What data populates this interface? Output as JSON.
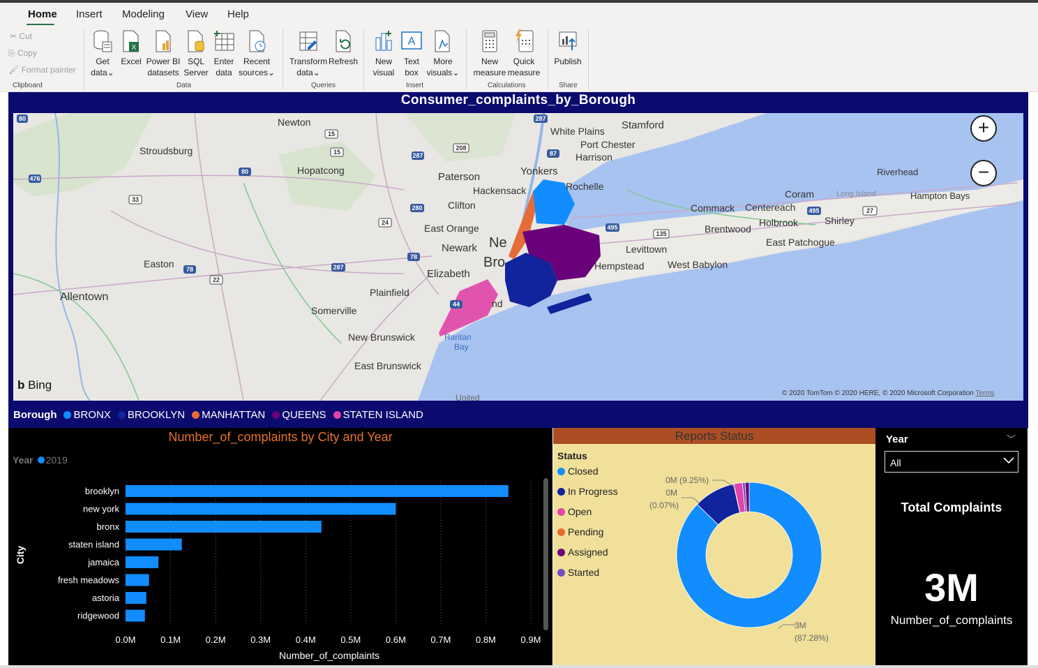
{
  "tabs": [
    "Home",
    "Insert",
    "Modeling",
    "View",
    "Help"
  ],
  "clipboard": {
    "cut": "Cut",
    "copy": "Copy",
    "format_painter": "Format painter",
    "group": "Clipboard"
  },
  "data_group": {
    "get_data": [
      "Get",
      "data"
    ],
    "excel": [
      "Excel",
      ""
    ],
    "powerbi_datasets": [
      "Power BI",
      "datasets"
    ],
    "sql_server": [
      "SQL",
      "Server"
    ],
    "enter_data": [
      "Enter",
      "data"
    ],
    "recent_sources": [
      "Recent",
      "sources"
    ],
    "group": "Data"
  },
  "queries_group": {
    "transform": [
      "Transform",
      "data"
    ],
    "refresh": [
      "Refresh",
      ""
    ],
    "group": "Queries"
  },
  "insert_group": {
    "new_visual": [
      "New",
      "visual"
    ],
    "text_box": [
      "Text",
      "box"
    ],
    "more_visuals": [
      "More",
      "visuals"
    ],
    "group": "Insert"
  },
  "calc_group": {
    "new_measure": [
      "New",
      "measure"
    ],
    "quick_measure": [
      "Quick",
      "measure"
    ],
    "group": "Calculations"
  },
  "share_group": {
    "publish": "Publish",
    "group": "Share"
  },
  "map": {
    "title": "Consumer_complaints_by_Borough",
    "zoom_in": "+",
    "zoom_out": "−",
    "bing": "Bing",
    "copyright": "© 2020 TomTom © 2020 HERE, © 2020 Microsoft Corporation",
    "terms": "Terms",
    "places": [
      "Newton",
      "Stroudsburg",
      "Hopatcong",
      "Paterson",
      "Hackensack",
      "Clifton",
      "East Orange",
      "Newark",
      "Elizabeth",
      "Plainfield",
      "Somerville",
      "New Brunswick",
      "East Brunswick",
      "Easton",
      "Allentown",
      "White Plains",
      "Port Chester",
      "Harrison",
      "Yonkers",
      "Rochelle",
      "Stamford",
      "Riverhead",
      "Coram",
      "Long Island",
      "Hampton Bays",
      "Commack",
      "Centereach",
      "Brentwood",
      "Holbrook",
      "Shirley",
      "East Patchogue",
      "Levittown",
      "Hempstead",
      "West Babylon",
      "Raritan",
      "Bay",
      "United",
      "Ne",
      "Bro",
      "nd"
    ],
    "shields": [
      "80",
      "476",
      "33",
      "15",
      "15",
      "208",
      "287",
      "287",
      "80",
      "280",
      "24",
      "78",
      "287",
      "78",
      "22",
      "87",
      "495",
      "495",
      "135",
      "27",
      "80",
      "44"
    ],
    "legend_title": "Borough",
    "legend": [
      {
        "name": "BRONX",
        "color": "#118dff"
      },
      {
        "name": "BROOKLYN",
        "color": "#12239e"
      },
      {
        "name": "MANHATTAN",
        "color": "#e66c37"
      },
      {
        "name": "QUEENS",
        "color": "#6b007b"
      },
      {
        "name": "STATEN ISLAND",
        "color": "#e044a7"
      }
    ]
  },
  "bar_chart": {
    "title": "Number_of_complaints by City and Year",
    "legend_title": "Year",
    "legend_item": "2019",
    "xlabel": "Number_of_complaints",
    "ylabel": "City"
  },
  "chart_data": [
    {
      "type": "bar",
      "orientation": "horizontal",
      "title": "Number_of_complaints by City and Year",
      "categories": [
        "brooklyn",
        "new york",
        "bronx",
        "staten island",
        "jamaica",
        "fresh meadows",
        "astoria",
        "ridgewood"
      ],
      "series": [
        {
          "name": "2019",
          "color": "#118dff",
          "values": [
            0.85,
            0.6,
            0.435,
            0.125,
            0.073,
            0.052,
            0.046,
            0.043
          ]
        }
      ],
      "xlabel": "Number_of_complaints",
      "ylabel": "City",
      "xlim": [
        0,
        0.9
      ],
      "x_ticks": [
        "0.0M",
        "0.1M",
        "0.2M",
        "0.3M",
        "0.4M",
        "0.5M",
        "0.6M",
        "0.7M",
        "0.8M",
        "0.9M"
      ],
      "value_unit": "M",
      "grid": true
    },
    {
      "type": "pie",
      "variant": "donut",
      "title": "Reports Status",
      "legend_title": "Status",
      "categories": [
        "Closed",
        "In Progress",
        "Open",
        "Pending",
        "Assigned",
        "Started"
      ],
      "colors": [
        "#118dff",
        "#12239e",
        "#e044a7",
        "#e66c37",
        "#6b007b",
        "#744ec2"
      ],
      "values": [
        87.28,
        9.25,
        1.9,
        0.07,
        0.9,
        0.6
      ],
      "labels": [
        {
          "value": "3M",
          "pct": "(87.28%)"
        },
        {
          "value": "0M (9.25%)",
          "pct": ""
        },
        {
          "value": "0M",
          "pct": "(0.07%)"
        }
      ]
    }
  ],
  "slicer": {
    "title": "Year",
    "value": "All"
  },
  "card": {
    "title": "Total Complaints",
    "value": "3M",
    "label": "Number_of_complaints"
  }
}
